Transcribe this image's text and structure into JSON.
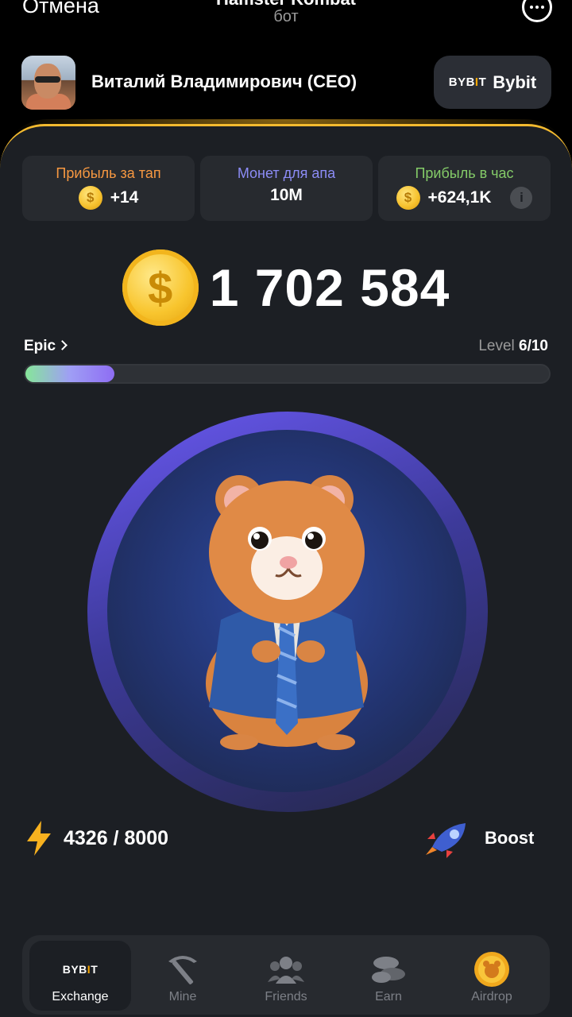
{
  "telegram": {
    "cancel_label": "Отмена",
    "title": "Hamster Kombat",
    "subtitle": "бот",
    "more_icon": "more-dots-icon"
  },
  "user": {
    "name": "Виталий Владимирович (CEO)",
    "exchange_button_logo": "BYB!T",
    "exchange_button_label": "Bybit"
  },
  "stats": [
    {
      "label": "Прибыль за тап",
      "value": "+14",
      "label_color": "#f79841"
    },
    {
      "label": "Монет для апа",
      "value": "10M",
      "label_color": "#8c8cf6"
    },
    {
      "label": "Прибыль в час",
      "value": "+624,1K",
      "label_color": "#84cb68"
    }
  ],
  "balance": "1 702 584",
  "league": {
    "name": "Epic",
    "level_prefix": "Level",
    "level_value": "6/10",
    "progress_fraction": 0.17
  },
  "energy": {
    "value": "4326 / 8000",
    "icon": "lightning-icon"
  },
  "boost": {
    "label": "Boost",
    "icon": "rocket-icon"
  },
  "nav": {
    "exchange_logo": "BYB!T",
    "items": [
      {
        "label": "Exchange",
        "active": true
      },
      {
        "label": "Mine",
        "active": false
      },
      {
        "label": "Friends",
        "active": false
      },
      {
        "label": "Earn",
        "active": false
      },
      {
        "label": "Airdrop",
        "active": false
      }
    ]
  },
  "colors": {
    "accent": "#f3ba2f",
    "background": "#1c1f24",
    "card": "#272a2f"
  }
}
